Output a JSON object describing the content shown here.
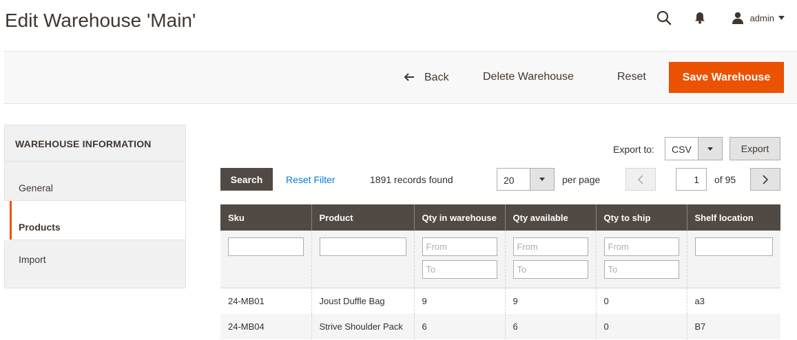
{
  "header": {
    "title": "Edit Warehouse 'Main'",
    "user": "admin"
  },
  "actions": {
    "back": "Back",
    "delete": "Delete Warehouse",
    "reset": "Reset",
    "save": "Save Warehouse"
  },
  "sidebar": {
    "title": "WAREHOUSE INFORMATION",
    "items": [
      {
        "label": "General"
      },
      {
        "label": "Products"
      },
      {
        "label": "Import"
      }
    ]
  },
  "toolbar": {
    "export_label": "Export to:",
    "export_format": "CSV",
    "export_button": "Export",
    "search_button": "Search",
    "reset_filter": "Reset Filter",
    "records_found": "1891 records found",
    "per_page_value": "20",
    "per_page_label": "per page",
    "current_page": "1",
    "of_pages": "of 95"
  },
  "grid": {
    "columns": [
      "Sku",
      "Product",
      "Qty in warehouse",
      "Qty available",
      "Qty to ship",
      "Shelf location"
    ],
    "filter_placeholders": {
      "from": "From",
      "to": "To"
    },
    "rows": [
      [
        "24-MB01",
        "Joust Duffle Bag",
        "9",
        "9",
        "0",
        "a3"
      ],
      [
        "24-MB04",
        "Strive Shoulder Pack",
        "6",
        "6",
        "0",
        "B7"
      ]
    ]
  },
  "colors": {
    "accent": "#eb5202",
    "header_dark": "#514943",
    "link": "#007bdb"
  }
}
